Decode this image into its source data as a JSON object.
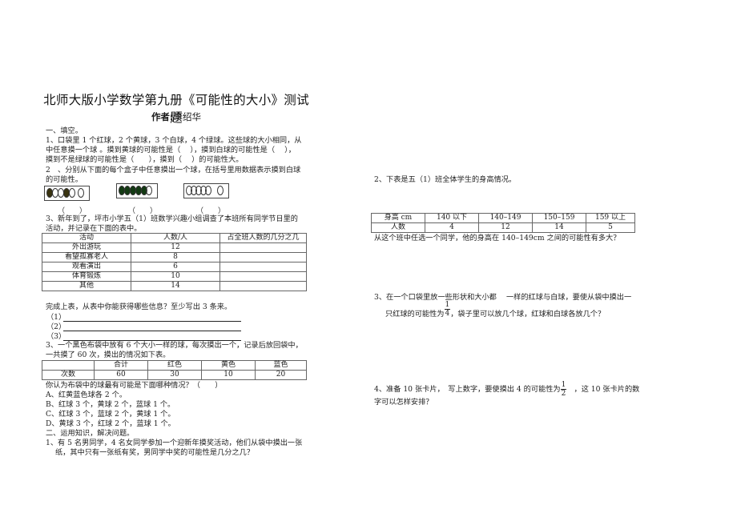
{
  "document": {
    "title": "北师大版小学数学第九册《可能性的大小》测试题",
    "author_label": "作者:",
    "author_name": "李绍华"
  },
  "left": {
    "section1_heading": "一、填空。",
    "q1_lines": [
      "1、口袋里 1 个红球，2 个黄球，3 个白球，4 个绿球。这些球的大小相同，从",
      "中任意摸一个球 。摸到黄球的可能性是（　 ），摸到白球的可能性是（　 ），",
      "摸到不是绿球的可能性是（　　），摸到（　 ）的可能性大。"
    ],
    "q2_lines": [
      "2　、分别从下面的每个盒子中任意摸出一个球，在括号里用数据表示摸到白球",
      "的可能性。"
    ],
    "ball_boxes": [
      {
        "balls": [
          "dark",
          "white",
          "white",
          "dark",
          "white",
          "white"
        ],
        "answer": "（　　）"
      },
      {
        "balls": [
          "dark",
          "dark",
          "dark",
          "dark",
          "dark",
          "white"
        ],
        "answer": "（　　）"
      },
      {
        "balls": [
          "white",
          "white",
          "white",
          "white",
          "white",
          "white"
        ],
        "answer": "（　　）"
      }
    ],
    "q3_lines": [
      "3、新年到了，坪市小学五（1）班数学兴趣小组调查了本班所有同学节日里的",
      "活动，并记录在下面的表中。"
    ],
    "activity_table": {
      "headers": [
        "活动",
        "人数/人",
        "占全班人数的几分之几"
      ],
      "rows": [
        [
          "外出游玩",
          "12",
          ""
        ],
        [
          "看望孤寡老人",
          "8",
          ""
        ],
        [
          "观看演出",
          "6",
          ""
        ],
        [
          "体育锻炼",
          "10",
          ""
        ],
        [
          "其他",
          "14",
          ""
        ]
      ]
    },
    "q3_followup": "完成上表，从表中你能获得哪些信息？至少写出 3 条来。",
    "answer_lines": [
      "（1）",
      "（2）",
      "（3）"
    ],
    "q3b_lines": [
      "3、一个黑色布袋中放有 6 个大小一样的球，每次摸出一个，记录后放回袋中，",
      "一共摸了 60 次，摸出的情况如下表。"
    ],
    "color_table": {
      "headers": [
        "",
        "合计",
        "红色",
        "黄色",
        "蓝色"
      ],
      "rows": [
        [
          "次数",
          "60",
          "30",
          "10",
          "20"
        ]
      ]
    },
    "q3b_question": "你认为布袋中的球最有可能是下面哪种情况？（　　）",
    "options": [
      "A、红黄蓝色球各 2 个。",
      "B、红球 3 个，黄球 2 个，蓝球 1 个。",
      "C、红球 3 个，蓝球 2 个，黄球 1 个。",
      "D、黄球 3 个，红球 2 个，蓝球 1 个。"
    ],
    "section2_heading": "二、运用知识，解决问题。",
    "s2q1_lines": [
      "1、有 5 名男同学，4 名女同学参加一个迎新年摸奖活动，他们从袋中摸出一张",
      "纸，其中只有一张纸有奖，男同学中奖的可能性是几分之几？"
    ]
  },
  "right": {
    "q2_intro": "2、下表是五（1）班全体学生的身高情况。",
    "height_table": {
      "headers": [
        "身高 cm",
        "140 以下",
        "140–149",
        "150–159",
        "159 以上"
      ],
      "rows": [
        [
          "人数",
          "4",
          "12",
          "14",
          "5"
        ]
      ]
    },
    "q2_question": "从这个班中任选一个同学，他的身高在 140–149cm 之间的可能性有多大？",
    "q3_line1": "3、在一个口袋里放一些形状和大小都　 一样的红球与白球，要使从袋中摸出一",
    "q3_line2_pre": "只红球的可能性为",
    "q3_frac": {
      "num": "1",
      "den": "4"
    },
    "q3_line2_post": "，袋子里可以放几个球，红球和白球各放几个？",
    "q4_line1_pre": "4、准备 10 张卡片，　写上数字，要使摸出 4 的可能性为",
    "q4_frac": {
      "num": "1",
      "den": "2"
    },
    "q4_line1_post": "　，这 10 张卡片的数",
    "q4_line2": "字可以怎样安排？"
  }
}
